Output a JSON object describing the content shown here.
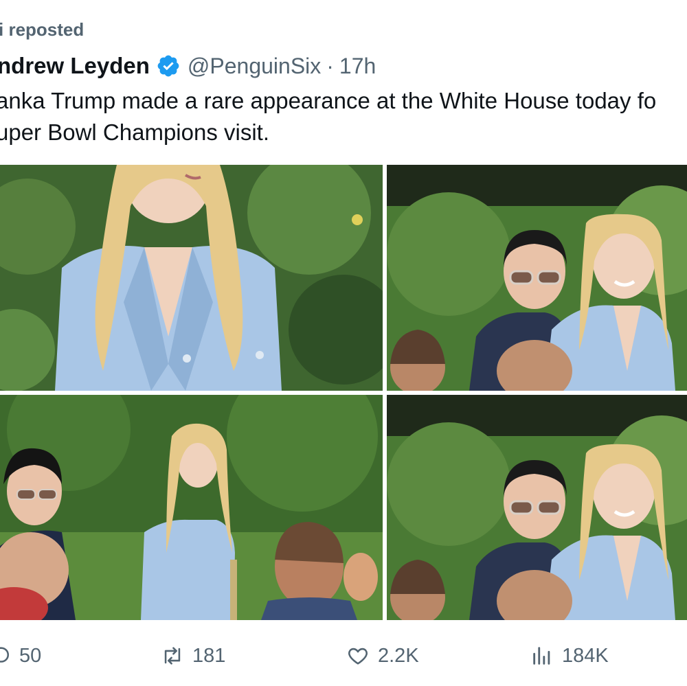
{
  "repost": {
    "text": "i reposted"
  },
  "author": {
    "name": "ndrew Leyden",
    "handle": "@PenguinSix",
    "separator": "·",
    "time": "17h",
    "verified_color": "#1d9bf0"
  },
  "tweet": {
    "text": "anka Trump made a rare appearance at the White House today fo\nuper Bowl Champions visit."
  },
  "media": {
    "photos": [
      {
        "subject": "woman with long blonde hair in light blue double-breasted blazer, hedge background"
      },
      {
        "subject": "blonde woman in light blue blazer smiling beside dark-haired woman in sunglasses"
      },
      {
        "subject": "wide shot of blonde woman in light blue blazer with crowd in front of hedge"
      },
      {
        "subject": "blonde woman in light blue blazer smiling beside dark-haired woman in sunglasses"
      }
    ]
  },
  "actions": {
    "reply": {
      "icon": "reply-icon",
      "count": "50"
    },
    "repost": {
      "icon": "repost-icon",
      "count": "181"
    },
    "like": {
      "icon": "heart-icon",
      "count": "2.2K"
    },
    "views": {
      "icon": "views-icon",
      "count": "184K"
    }
  },
  "colors": {
    "text_primary": "#0f1419",
    "text_secondary": "#536471",
    "blazer": "#a9c6e6",
    "hair": "#e6c98a",
    "hedge": "#4d7a35"
  }
}
